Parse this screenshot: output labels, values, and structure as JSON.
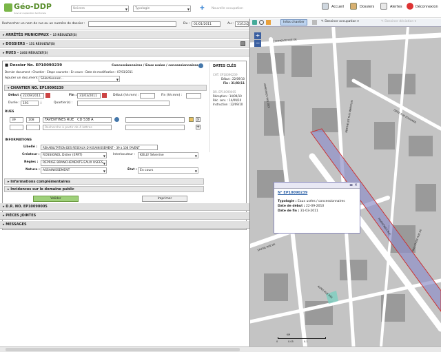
{
  "app": {
    "name": "Géo-DDP",
    "tagline": "Suivi et coopération territoriale",
    "colors": {
      "brand": "#5a8f2e",
      "accent": "#3366aa",
      "highlight": "#9090c8"
    }
  },
  "topbar": {
    "univers": "Univers",
    "typologie": "Typologie",
    "new_occ": "Nouvelle occupation",
    "accueil": "Accueil",
    "dossiers": "Dossiers",
    "alertes": "Alertes",
    "deconnexion": "Déconnexion"
  },
  "search": {
    "label": "Rechercher un nom de rue ou un numéro de dossier :",
    "du_label": "Du :",
    "du": "01/01/2011",
    "au_label": "Au :",
    "au": "31/12/2011"
  },
  "accordions": [
    {
      "title": "ARRÊTÉS MUNICIPAUX",
      "count": "15 RÉSULTAT(S)"
    },
    {
      "title": "DOSSIERS",
      "count": "151 RÉSULTAT(S)"
    },
    {
      "title": "RUES",
      "count": "2402 RÉSULTAT(S)"
    }
  ],
  "dossier": {
    "title": "Dossier No. EP10090239",
    "type": "Concessionnaires / Eaux usées / concessionnaires",
    "last_doc": "Dernier document : Chantier - Etape courante : En cours - Date de modification : 07/03/2011",
    "add_doc_label": "Ajouter un document :",
    "add_doc_value": "Sélectionnez...",
    "chantier_title": "CHANTIER NO. EP10090239",
    "debut_label": "Début :",
    "debut": "22/09/2011",
    "fin_label": "Fin :",
    "fin": "31/03/2011",
    "debut_hm": "Début (hh:mm) :",
    "fin_hm": "Fin (hh:mm) :",
    "duree_label": "Durée :",
    "duree": "191",
    "quartier_label": "Quartier(s) :",
    "rues_title": "RUES",
    "rue_num1": "39",
    "rue_num2": "108",
    "rue_name": "FAVENTINES RUE",
    "rue_code": "CD 538 A",
    "rue_placeholder": "Recherche à partir de 4 lettres",
    "info_title": "INFORMATIONS",
    "libelle_label": "Libellé :",
    "libelle": "REHABILITATION DES RESEAUX D'ASSAINISSEMENT - 39 à 108 FAVENT",
    "createur_label": "Créateur :",
    "createur": "ROSSIGNOL Didier (EPRT)",
    "interloc_label": "Interlocuteur :",
    "interloc": "KOLLY Séverine",
    "regies_label": "Régies :",
    "regies": "REPRISE BRANCHEMENTS EAUX USEES",
    "nature_label": "Nature :",
    "nature": "ASSAINISSEMENT",
    "etat_label": "État :",
    "etat": "En cours",
    "info_compl": "Informations complémentaires",
    "incidences": "Incidences sur le domaine public",
    "valider": "Valider",
    "imprimer": "Imprimer"
  },
  "dates_cles": {
    "title": "DATES CLÉS",
    "cht": "CHT. EP10090239",
    "cht_debut_l": "Début :",
    "cht_debut": "22/09/10",
    "cht_fin_l": "Fin :",
    "cht_fin": "31/03/11",
    "dr": "DR. EP10090005",
    "dr_rec_l": "Réception :",
    "dr_rec": "14/09/10",
    "dr_serv_l": "Réc. serv. :",
    "dr_serv": "14/09/10",
    "dr_inst_l": "Instruction :",
    "dr_inst": "22/09/10"
  },
  "lower": [
    "D.R. NO. EP10090005",
    "PIÈCES JOINTES",
    "MESSAGES"
  ],
  "map": {
    "toolbar": {
      "infos": "Infos chantier",
      "dessiner_occ": "Dessiner occupation",
      "dessiner_dev": "Dessiner déviation"
    },
    "streets": [
      "COMMERCE RUE DE",
      "ARMOIRIES RUE DES",
      "BERTHELOT RUE MARCELIN",
      "FAVENTINES RUE",
      "GUYNEMER AVENUE",
      "ILLE RUE DE L'",
      "ISERE RUE EDOUARD",
      "VILLARD RUE MARCEL",
      "MULHOUSE RUE DE",
      "ALPES RUE DES",
      "SAVOIE RUE DE",
      "JARDIN RUE DE L'",
      "CHENE RUE DU",
      "VIGNES RUE DES",
      "SOLEIL RUE DU",
      "PAVIE RUE DE"
    ],
    "scale_label": "KM",
    "scale_0": "0",
    "scale_1": "0.05",
    "scale_2": "0.1",
    "popup": {
      "title": "N° EP10090239",
      "typo_l": "Typologie :",
      "typo": "Eaux usées / concessionnaires",
      "deb_l": "Date de début :",
      "deb": "22-09-2010",
      "fin_l": "Date de fin :",
      "fin": "31-03-2011"
    }
  }
}
